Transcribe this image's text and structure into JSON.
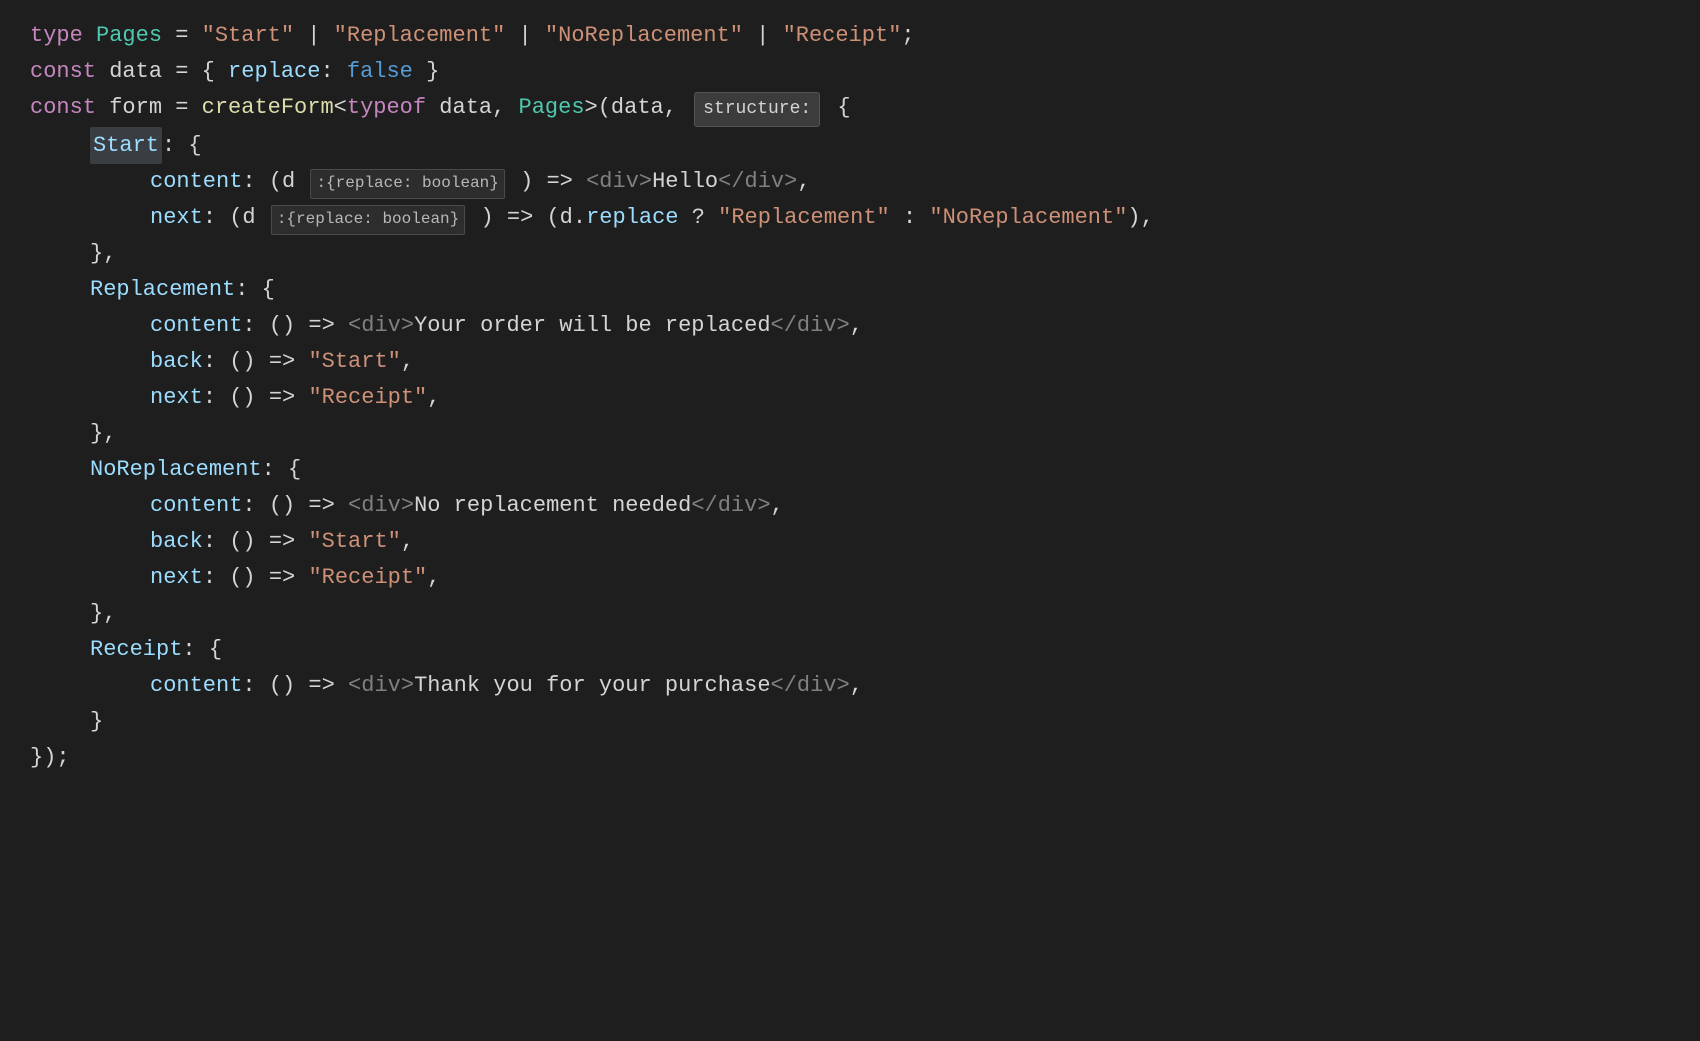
{
  "editor": {
    "background": "#1e1e1e",
    "lines": [
      {
        "id": "line1",
        "tokens": [
          {
            "type": "kw",
            "text": "type "
          },
          {
            "type": "type-name",
            "text": "Pages"
          },
          {
            "type": "plain",
            "text": " = "
          },
          {
            "type": "str",
            "text": "\"Start\""
          },
          {
            "type": "plain",
            "text": " | "
          },
          {
            "type": "str",
            "text": "\"Replacement\""
          },
          {
            "type": "plain",
            "text": " | "
          },
          {
            "type": "str",
            "text": "\"NoReplacement\""
          },
          {
            "type": "plain",
            "text": " | "
          },
          {
            "type": "str",
            "text": "\"Receipt\""
          },
          {
            "type": "plain",
            "text": ";"
          }
        ]
      },
      {
        "id": "line2",
        "tokens": [
          {
            "type": "kw",
            "text": "const "
          },
          {
            "type": "plain",
            "text": "data = { "
          },
          {
            "type": "prop",
            "text": "replace"
          },
          {
            "type": "plain",
            "text": ": "
          },
          {
            "type": "bool",
            "text": "false"
          },
          {
            "type": "plain",
            "text": " }"
          }
        ]
      },
      {
        "id": "line3",
        "tokens": [
          {
            "type": "kw",
            "text": "const "
          },
          {
            "type": "plain",
            "text": "form = "
          },
          {
            "type": "fn",
            "text": "createForm"
          },
          {
            "type": "plain",
            "text": "<"
          },
          {
            "type": "kw",
            "text": "typeof "
          },
          {
            "type": "plain",
            "text": "data, "
          },
          {
            "type": "type-name",
            "text": "Pages"
          },
          {
            "type": "plain",
            "text": ">(data, "
          },
          {
            "type": "tooltip",
            "text": "structure:"
          },
          {
            "type": "plain",
            "text": " {"
          }
        ]
      },
      {
        "id": "line4",
        "tokens": [
          {
            "type": "indent1",
            "text": ""
          },
          {
            "type": "section-key-start",
            "text": "Start"
          },
          {
            "type": "plain",
            "text": ": {"
          }
        ]
      },
      {
        "id": "line5",
        "tokens": [
          {
            "type": "indent2",
            "text": ""
          },
          {
            "type": "prop",
            "text": "content"
          },
          {
            "type": "plain",
            "text": ": ("
          },
          {
            "type": "plain",
            "text": "d "
          },
          {
            "type": "param-hint",
            "text": ":{replace: boolean}"
          },
          {
            "type": "plain",
            "text": " ) => "
          },
          {
            "type": "jsx-tag",
            "text": "<div>"
          },
          {
            "type": "jsx-content",
            "text": "Hello"
          },
          {
            "type": "jsx-tag",
            "text": "</div>"
          },
          {
            "type": "plain",
            "text": ","
          }
        ]
      },
      {
        "id": "line6",
        "tokens": [
          {
            "type": "indent2",
            "text": ""
          },
          {
            "type": "prop",
            "text": "next"
          },
          {
            "type": "plain",
            "text": ": ("
          },
          {
            "type": "plain",
            "text": "d "
          },
          {
            "type": "param-hint",
            "text": ":{replace: boolean}"
          },
          {
            "type": "plain",
            "text": " ) => (d."
          },
          {
            "type": "prop",
            "text": "replace"
          },
          {
            "type": "plain",
            "text": " ? "
          },
          {
            "type": "str",
            "text": "\"Replacement\""
          },
          {
            "type": "plain",
            "text": " : "
          },
          {
            "type": "str",
            "text": "\"NoReplacement\""
          },
          {
            "type": "plain",
            "text": "),"
          }
        ]
      },
      {
        "id": "line7",
        "tokens": [
          {
            "type": "indent1",
            "text": ""
          },
          {
            "type": "plain",
            "text": "},"
          }
        ]
      },
      {
        "id": "line8",
        "tokens": [
          {
            "type": "indent1",
            "text": ""
          },
          {
            "type": "section-key",
            "text": "Replacement"
          },
          {
            "type": "plain",
            "text": ": {"
          }
        ]
      },
      {
        "id": "line9",
        "tokens": [
          {
            "type": "indent2",
            "text": ""
          },
          {
            "type": "prop",
            "text": "content"
          },
          {
            "type": "plain",
            "text": ": () => "
          },
          {
            "type": "jsx-tag",
            "text": "<div>"
          },
          {
            "type": "jsx-content",
            "text": "Your order will be replaced"
          },
          {
            "type": "jsx-tag",
            "text": "</div>"
          },
          {
            "type": "plain",
            "text": ","
          }
        ]
      },
      {
        "id": "line10",
        "tokens": [
          {
            "type": "indent2",
            "text": ""
          },
          {
            "type": "prop",
            "text": "back"
          },
          {
            "type": "plain",
            "text": ": () => "
          },
          {
            "type": "str",
            "text": "\"Start\""
          },
          {
            "type": "plain",
            "text": ","
          }
        ]
      },
      {
        "id": "line11",
        "tokens": [
          {
            "type": "indent2",
            "text": ""
          },
          {
            "type": "prop",
            "text": "next"
          },
          {
            "type": "plain",
            "text": ": () => "
          },
          {
            "type": "str",
            "text": "\"Receipt\""
          },
          {
            "type": "plain",
            "text": ","
          }
        ]
      },
      {
        "id": "line12",
        "tokens": [
          {
            "type": "indent1",
            "text": ""
          },
          {
            "type": "plain",
            "text": "},"
          }
        ]
      },
      {
        "id": "line13",
        "tokens": [
          {
            "type": "indent1",
            "text": ""
          },
          {
            "type": "section-key",
            "text": "NoReplacement"
          },
          {
            "type": "plain",
            "text": ": {"
          }
        ]
      },
      {
        "id": "line14",
        "tokens": [
          {
            "type": "indent2",
            "text": ""
          },
          {
            "type": "prop",
            "text": "content"
          },
          {
            "type": "plain",
            "text": ": () => "
          },
          {
            "type": "jsx-tag",
            "text": "<div>"
          },
          {
            "type": "jsx-content",
            "text": "No replacement needed"
          },
          {
            "type": "jsx-tag",
            "text": "</div>"
          },
          {
            "type": "plain",
            "text": ","
          }
        ]
      },
      {
        "id": "line15",
        "tokens": [
          {
            "type": "indent2",
            "text": ""
          },
          {
            "type": "prop",
            "text": "back"
          },
          {
            "type": "plain",
            "text": ": () => "
          },
          {
            "type": "str",
            "text": "\"Start\""
          },
          {
            "type": "plain",
            "text": ","
          }
        ]
      },
      {
        "id": "line16",
        "tokens": [
          {
            "type": "indent2",
            "text": ""
          },
          {
            "type": "prop",
            "text": "next"
          },
          {
            "type": "plain",
            "text": ": () => "
          },
          {
            "type": "str",
            "text": "\"Receipt\""
          },
          {
            "type": "plain",
            "text": ","
          }
        ]
      },
      {
        "id": "line17",
        "tokens": [
          {
            "type": "indent1",
            "text": ""
          },
          {
            "type": "plain",
            "text": "},"
          }
        ]
      },
      {
        "id": "line18",
        "tokens": [
          {
            "type": "indent1",
            "text": ""
          },
          {
            "type": "section-key",
            "text": "Receipt"
          },
          {
            "type": "plain",
            "text": ": {"
          }
        ]
      },
      {
        "id": "line19",
        "tokens": [
          {
            "type": "indent2",
            "text": ""
          },
          {
            "type": "prop",
            "text": "content"
          },
          {
            "type": "plain",
            "text": ": () => "
          },
          {
            "type": "jsx-tag",
            "text": "<div>"
          },
          {
            "type": "jsx-content",
            "text": "Thank you for your purchase"
          },
          {
            "type": "jsx-tag",
            "text": "</div>"
          },
          {
            "type": "plain",
            "text": ","
          }
        ]
      },
      {
        "id": "line20",
        "tokens": [
          {
            "type": "indent1",
            "text": ""
          },
          {
            "type": "plain",
            "text": "}"
          }
        ]
      },
      {
        "id": "line21",
        "tokens": [
          {
            "type": "plain",
            "text": "});"
          }
        ]
      }
    ]
  }
}
